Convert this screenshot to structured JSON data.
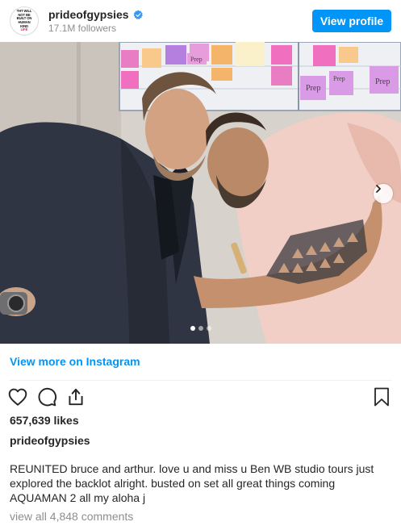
{
  "header": {
    "avatar_text": [
      "THT WILL",
      "NOT BE",
      "BUILT ON",
      "HUMAN",
      "KIND",
      "LIFE"
    ],
    "username": "prideofgypsies",
    "followers": "17.1M followers",
    "view_profile_label": "View profile",
    "verified_icon": "verified-badge"
  },
  "photo": {
    "board_notes": [
      "Prep",
      "Prep",
      "Prep",
      "Prep"
    ],
    "carousel": {
      "total": 3,
      "active_index": 0
    }
  },
  "view_more_label": "View more on Instagram",
  "actions": {
    "icons": [
      "heart-icon",
      "comment-icon",
      "share-icon",
      "bookmark-icon"
    ]
  },
  "likes": "657,639 likes",
  "caption_username": "prideofgypsies",
  "caption": {
    "line1": "REUNITED bruce and arthur. love u and miss u Ben WB studio tours just",
    "line2": "explored the backlot alright. busted on set all great things coming",
    "line3": "AQUAMAN 2 all my aloha j"
  },
  "comments_label": "view all 4,848 comments",
  "colors": {
    "accent": "#0095f6",
    "text": "#262626",
    "muted": "#8e8e8e"
  }
}
